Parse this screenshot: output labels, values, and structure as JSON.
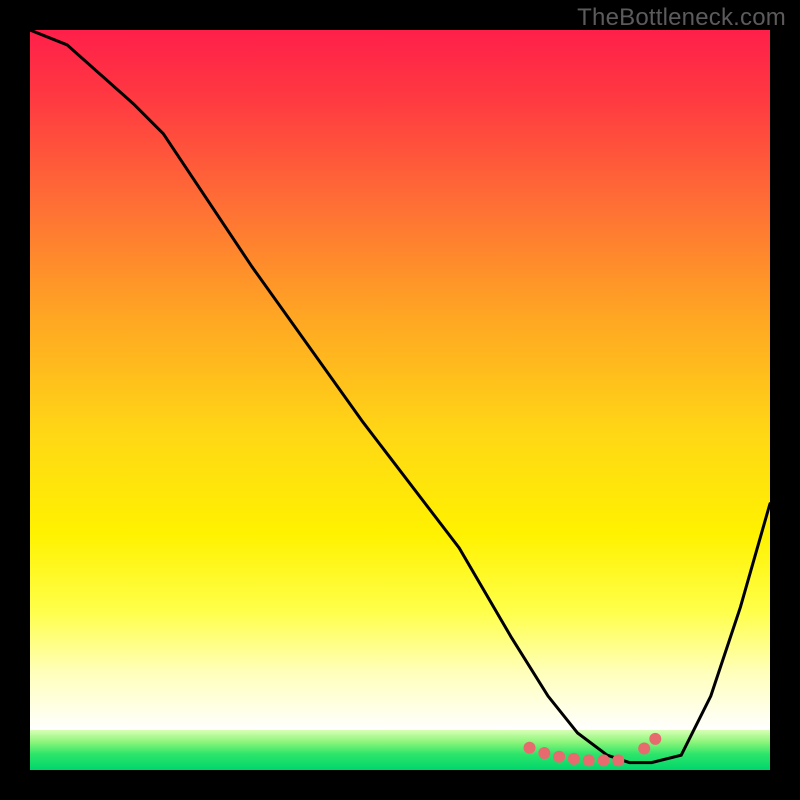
{
  "watermark": "TheBottleneck.com",
  "chart_data": {
    "type": "line",
    "title": "",
    "xlabel": "",
    "ylabel": "",
    "xlim": [
      0,
      100
    ],
    "ylim": [
      0,
      100
    ],
    "grid": false,
    "series": [
      {
        "name": "bottleneck-curve",
        "x": [
          0,
          5,
          14,
          18,
          30,
          45,
          58,
          65,
          70,
          74,
          78,
          81,
          84,
          88,
          92,
          96,
          100
        ],
        "y": [
          100,
          98,
          90,
          86,
          68,
          47,
          30,
          18,
          10,
          5,
          2,
          1,
          1,
          2,
          10,
          22,
          36
        ]
      }
    ],
    "markers": {
      "name": "optimal-range",
      "x": [
        67.5,
        69.5,
        71.5,
        73.5,
        75.5,
        77.5,
        79.5,
        83.0,
        84.5
      ],
      "y": [
        3.0,
        2.3,
        1.8,
        1.5,
        1.3,
        1.3,
        1.3,
        2.9,
        4.2
      ]
    },
    "colors": {
      "curve": "#000000",
      "markers": "#e76a6f",
      "gradient_top": "#ff1f4a",
      "gradient_mid": "#fff200",
      "gradient_green": "#00d66b",
      "frame": "#000000"
    }
  }
}
